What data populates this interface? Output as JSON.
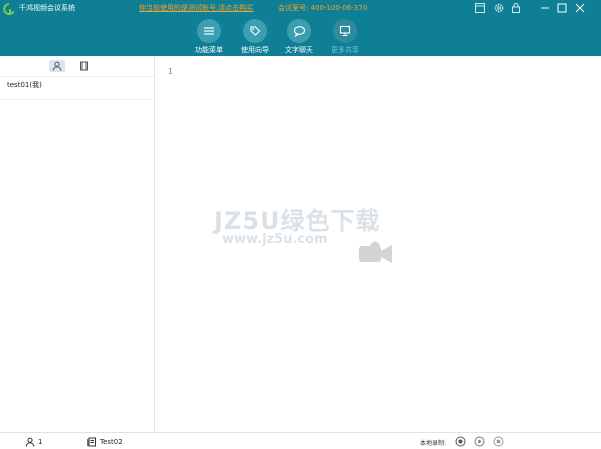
{
  "app": {
    "title": "千鸿视频会议系统",
    "notice": "你当前使用的是测试帐号,请点击购买",
    "meeting_id": "会议室号: 400-100-06-370"
  },
  "toolbar": {
    "items": [
      {
        "label": "功能菜单",
        "icon": "menu-icon"
      },
      {
        "label": "使用向导",
        "icon": "tag-icon"
      },
      {
        "label": "文字聊天",
        "icon": "chat-icon"
      },
      {
        "label": "更多共享",
        "icon": "monitor-icon"
      }
    ]
  },
  "sidebar": {
    "tabs": [
      {
        "icon": "user-icon",
        "active": true
      },
      {
        "icon": "film-icon",
        "active": false
      }
    ],
    "users": [
      "test01(我)"
    ]
  },
  "editor": {
    "line_numbers": [
      "1"
    ]
  },
  "watermark": {
    "brand": "JZ5U绿色下载",
    "url": "www.jz5u.com"
  },
  "status": {
    "user_count": "1",
    "document": "Test02",
    "record_label": "本地录制:"
  },
  "colors": {
    "topbar": "#0f7f95",
    "highlight": "#f6a32a"
  }
}
